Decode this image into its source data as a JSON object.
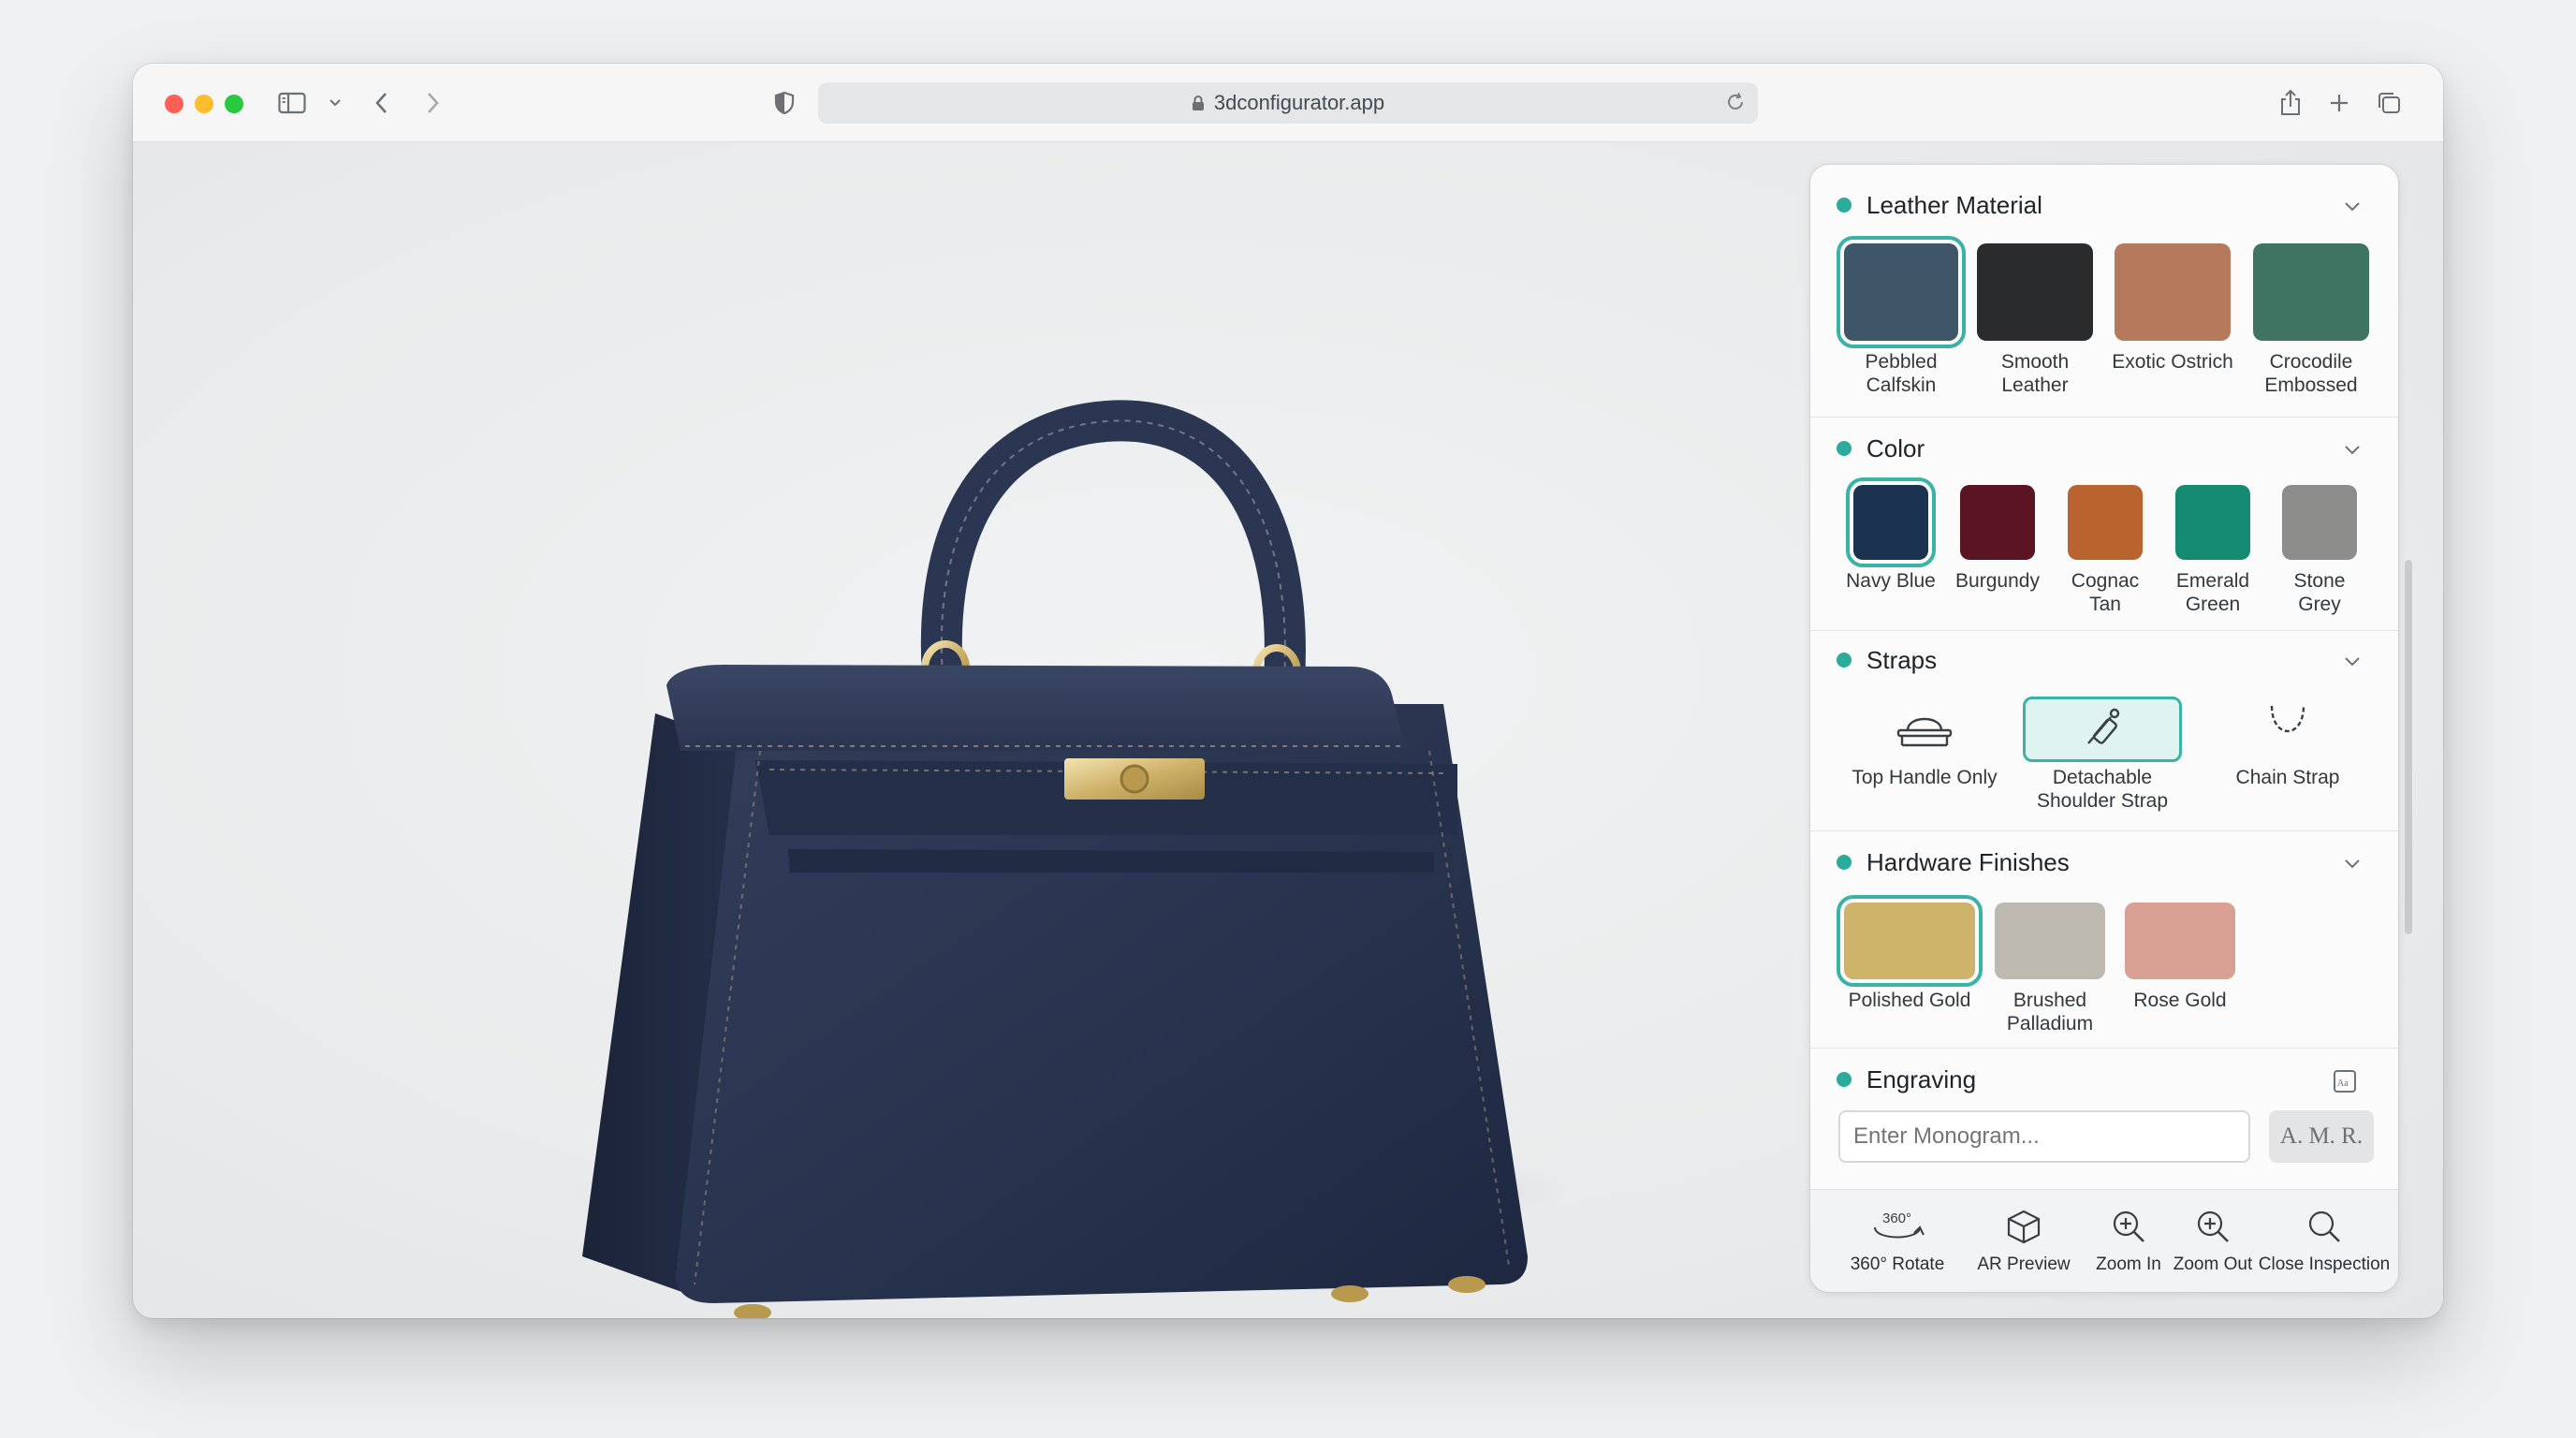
{
  "browser": {
    "url": "3dconfigurator.app"
  },
  "panel": {
    "leather": {
      "title": "Leather Material",
      "options": [
        {
          "label": "Pebbled\nCalfskin",
          "color": "#3f5668",
          "selected": true
        },
        {
          "label": "Smooth\nLeather",
          "color": "#2a2b2d",
          "selected": false
        },
        {
          "label": "Exotic Ostrich",
          "color": "#b57a5c",
          "selected": false
        },
        {
          "label": "Crocodile\nEmbossed",
          "color": "#3f7463",
          "selected": false
        }
      ]
    },
    "color": {
      "title": "Color",
      "options": [
        {
          "label": "Navy Blue",
          "color": "#1b3350",
          "selected": true
        },
        {
          "label": "Burgundy",
          "color": "#5a1424",
          "selected": false
        },
        {
          "label": "Cognac\nTan",
          "color": "#b9642f",
          "selected": false
        },
        {
          "label": "Emerald\nGreen",
          "color": "#148b70",
          "selected": false
        },
        {
          "label": "Stone\nGrey",
          "color": "#8c8c8a",
          "selected": false
        }
      ]
    },
    "straps": {
      "title": "Straps",
      "options": [
        {
          "label": "Top Handle Only",
          "icon": "top-handle-icon",
          "selected": false
        },
        {
          "label": "Detachable\nShoulder Strap",
          "icon": "shoulder-strap-icon",
          "selected": true
        },
        {
          "label": "Chain Strap",
          "icon": "chain-strap-icon",
          "selected": false
        }
      ]
    },
    "hardware": {
      "title": "Hardware Finishes",
      "options": [
        {
          "label": "Polished Gold",
          "color": "#cdb46a",
          "selected": true
        },
        {
          "label": "Brushed\nPalladium",
          "color": "#bdb9b0",
          "selected": false
        },
        {
          "label": "Rose Gold",
          "color": "#d7a092",
          "selected": false
        }
      ]
    },
    "engraving": {
      "title": "Engraving",
      "placeholder": "Enter Monogram...",
      "preview": "A. M. R."
    }
  },
  "bottom_bar": [
    {
      "label": "360° Rotate",
      "icon": "rotate-360-icon"
    },
    {
      "label": "AR Preview",
      "icon": "ar-cube-icon"
    },
    {
      "label": "Zoom In",
      "icon": "zoom-in-icon"
    },
    {
      "label": "Zoom Out",
      "icon": "zoom-out-icon"
    },
    {
      "label": "Close Inspection",
      "icon": "magnifier-icon"
    }
  ],
  "colors": {
    "accent": "#2aab9b",
    "bag_navy": "#27344f",
    "hardware_gold": "#d7bf7e"
  }
}
